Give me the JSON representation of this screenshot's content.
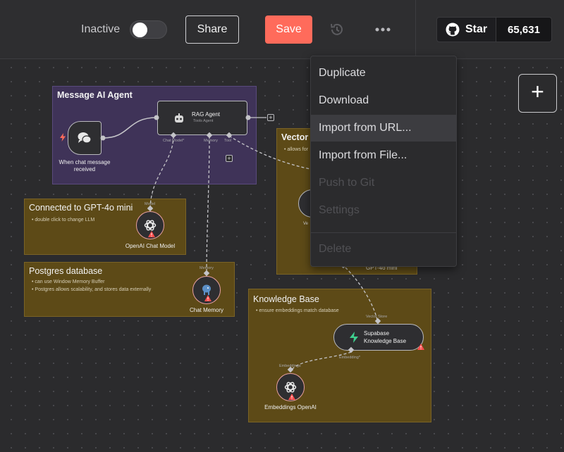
{
  "header": {
    "toggle_label": "Inactive",
    "share_label": "Share",
    "save_label": "Save",
    "github_star_label": "Star",
    "github_star_count": "65,631",
    "accent_color": "#ff6b5b"
  },
  "menu": {
    "items": [
      {
        "label": "Duplicate",
        "state": "enabled"
      },
      {
        "label": "Download",
        "state": "enabled"
      },
      {
        "label": "Import from URL...",
        "state": "hover"
      },
      {
        "label": "Import from File...",
        "state": "enabled"
      },
      {
        "label": "Push to Git",
        "state": "disabled"
      },
      {
        "label": "Settings",
        "state": "disabled"
      },
      {
        "label": "Delete",
        "state": "disabled"
      }
    ]
  },
  "canvas": {
    "agent_group": {
      "title": "Message AI Agent",
      "trigger_label": "When chat message received",
      "agent_title": "RAG Agent",
      "agent_subtitle": "Tools Agent",
      "port_chat_model": "Chat Model*",
      "port_memory": "Memory",
      "port_tool": "Tool"
    },
    "sticky_llm": {
      "title": "Connected to GPT-4o mini",
      "bullets": [
        "double click to change LLM"
      ],
      "node_label": "OpenAI Chat Model",
      "port_label": "Model"
    },
    "sticky_postgres": {
      "title": "Postgres database",
      "bullets": [
        "can use Window Memory Buffer",
        "Postgres allows scalability, and stores data externally"
      ],
      "node_label": "Chat Memory",
      "port_label": "Memory"
    },
    "sticky_vector": {
      "title_partial": "Vector",
      "bullet_partial": "allows for",
      "model_partial": "GPT-4o mini",
      "node_partial": "Ve"
    },
    "sticky_kb": {
      "title": "Knowledge Base",
      "bullets": [
        "ensure embeddings match database"
      ],
      "kb_port_label": "Vector Store",
      "kb_node_label_line1": "Supabase",
      "kb_node_label_line2": "Knowledge Base",
      "embedding_port_label": "Embedding*",
      "embeddings_port_label": "Embeddings",
      "embeddings_node_label": "Embeddings OpenAI"
    }
  }
}
